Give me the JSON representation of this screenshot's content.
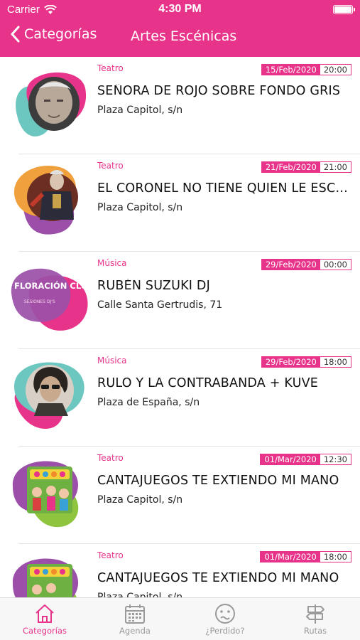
{
  "status_bar": {
    "carrier": "Carrier",
    "time": "4:30 PM"
  },
  "navbar": {
    "back_label": "Categorías",
    "title": "Artes Escénicas"
  },
  "colors": {
    "accent": "#e8338a",
    "teal": "#6cc7c0",
    "purple": "#9b4fa8",
    "orange": "#f0a03c",
    "green": "#8fc43f"
  },
  "events": [
    {
      "category": "Teatro",
      "date": "15/Feb/2020",
      "time": "20:00",
      "title": "SEÑORA DE ROJO SOBRE FONDO GRIS",
      "venue": "Plaza Capitol, s/n",
      "thumb": "portrait-old-man"
    },
    {
      "category": "Teatro",
      "date": "21/Feb/2020",
      "time": "21:00",
      "title": "EL CORONEL NO TIENE QUIEN LE ESCR…",
      "venue": "Plaza Capitol, s/n",
      "thumb": "portrait-colonel"
    },
    {
      "category": "Música",
      "date": "29/Feb/2020",
      "time": "00:00",
      "title": "RUBÉN SUZUKI DJ",
      "venue": "Calle Santa Gertrudis, 71",
      "thumb": "floracion-club-logo",
      "thumb_text": "FLORACIÓN CLUB",
      "thumb_subtext": "SESIONES DJ'S"
    },
    {
      "category": "Música",
      "date": "29/Feb/2020",
      "time": "18:00",
      "title": "RULO Y LA CONTRABANDA + KUVE",
      "venue": "Plaza de España, s/n",
      "thumb": "portrait-singer"
    },
    {
      "category": "Teatro",
      "date": "01/Mar/2020",
      "time": "12:30",
      "title": "CANTAJUEGOS TE EXTIENDO MI MANO",
      "venue": "Plaza Capitol, s/n",
      "thumb": "cantajuegos-poster"
    },
    {
      "category": "Teatro",
      "date": "01/Mar/2020",
      "time": "18:00",
      "title": "CANTAJUEGOS TE EXTIENDO MI MANO",
      "venue": "Plaza Capitol, s/n",
      "thumb": "cantajuegos-poster"
    }
  ],
  "tabs": [
    {
      "label": "Categorías",
      "icon": "house-icon",
      "active": true
    },
    {
      "label": "Agenda",
      "icon": "calendar-icon",
      "active": false
    },
    {
      "label": "¿Perdido?",
      "icon": "confused-face-icon",
      "active": false
    },
    {
      "label": "Rutas",
      "icon": "signpost-icon",
      "active": false
    }
  ]
}
